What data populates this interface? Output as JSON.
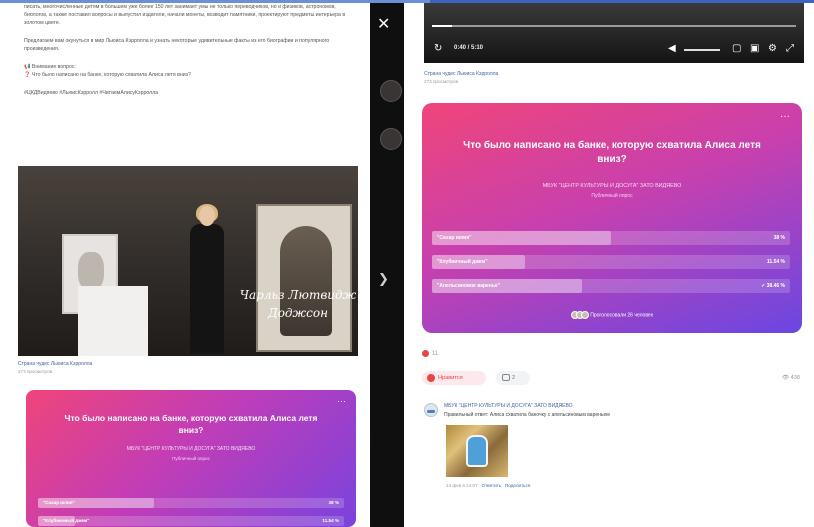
{
  "left": {
    "paragraph1": "писать, многочисленные детям в большем уже более 150 лет занимает умы не только переводчиков, но и физиков, астрономов, биологов, а также поставил вопросы и выпустил издатели, начали монеты, возводит памятники, проектируют предметы интерьера в золотом цвете.",
    "paragraph2": "Предлагаем вам окунуться в мир Льюиса Кэрролла и узнать некоторые удивительные факты из его биографии и популярного произведения.",
    "quiz_title": "Внимание вопрос:",
    "quiz_question": "Что было написано на банке, которую схватила Алиса летя вниз?",
    "hashtags": "#ЦКДВидяево #ЛьюисКэрролл #ЧитаемАлисуКэрролла",
    "video_caption": "Чарльз Лютвидж Доджсон",
    "video_source": "Страна чудес Льюиса Кэрролла",
    "video_views": "273 просмотров",
    "poll": {
      "question": "Что было написано на банке, которую схватила Алиса летя вниз?",
      "org": "МБУК \"ЦЕНТР КУЛЬТУРЫ И ДОСУГА\" ЗАТО ВИДЯЕВО",
      "kind": "Публичный опрос",
      "options": [
        {
          "label": "\"Сахар юлия\"",
          "pct": "38 %"
        },
        {
          "label": "\"Клубничный джем\"",
          "pct": "11.54 %"
        }
      ]
    }
  },
  "strip": {
    "close_icon": "close-icon",
    "next_icon": "chevron-right-icon"
  },
  "right": {
    "player": {
      "time": "0:40 / 5:10"
    },
    "video_source": "Страна чудес Льюиса Кэрролла",
    "video_views": "273 просмотров",
    "poll": {
      "question": "Что было написано на банке, которую схватила Алиса летя вниз?",
      "org": "МБУК \"ЦЕНТР КУЛЬТУРЫ И ДОСУГА\" ЗАТО ВИДЯЕВО",
      "kind": "Публичный опрос",
      "options": [
        {
          "label": "\"Сахар юлия\"",
          "pct": "38 %",
          "fill": 0.38
        },
        {
          "label": "\"Клубничный джем\"",
          "pct": "11.54 %",
          "fill": 0.12
        },
        {
          "label": "\"Апельсиновое варенье\"",
          "pct": "✓ 38.46 %",
          "fill": 0.38
        }
      ],
      "voters": "Проголосовали 26 человек"
    },
    "reactions_count": "11",
    "like_label": "Нравится",
    "comments_count": "2",
    "views": "438",
    "comment": {
      "author": "МБУК \"ЦЕНТР КУЛЬТУРЫ И ДОСУГА\" ЗАТО ВИДЯЕВО",
      "text": "Правильный ответ: Алиса схватила баночку с апельсиновым вареньем",
      "date": "14 фев в 14:07",
      "reply": "Ответить",
      "share": "Поделиться"
    }
  },
  "colors": {
    "poll_start": "#f0457a",
    "poll_mid": "#c23db6",
    "poll_end": "#7a43de",
    "link": "#3f62a8",
    "like": "#e64646"
  }
}
